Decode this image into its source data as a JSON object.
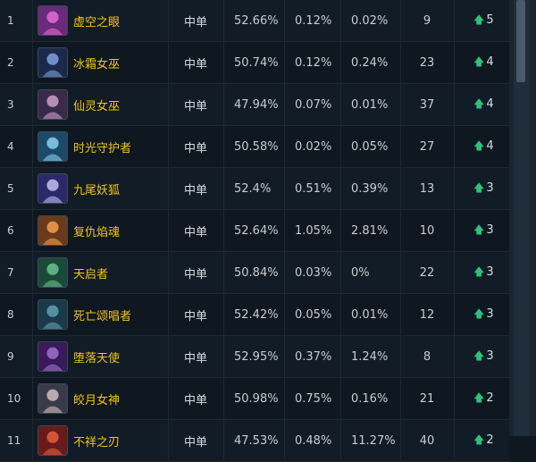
{
  "colors": {
    "name": "#f0c419",
    "trend_up": "#2ec27e"
  },
  "rows": [
    {
      "rank": "1",
      "icon": "champion-portrait-icon",
      "name": "虚空之眼",
      "pos": "中单",
      "win": "52.66%",
      "pick": "0.12%",
      "ban": "0.02%",
      "tier": "9",
      "trend": "5"
    },
    {
      "rank": "2",
      "icon": "champion-portrait-icon",
      "name": "冰霜女巫",
      "pos": "中单",
      "win": "50.74%",
      "pick": "0.12%",
      "ban": "0.24%",
      "tier": "23",
      "trend": "4"
    },
    {
      "rank": "3",
      "icon": "champion-portrait-icon",
      "name": "仙灵女巫",
      "pos": "中单",
      "win": "47.94%",
      "pick": "0.07%",
      "ban": "0.01%",
      "tier": "37",
      "trend": "4"
    },
    {
      "rank": "4",
      "icon": "champion-portrait-icon",
      "name": "时光守护者",
      "pos": "中单",
      "win": "50.58%",
      "pick": "0.02%",
      "ban": "0.05%",
      "tier": "27",
      "trend": "4"
    },
    {
      "rank": "5",
      "icon": "champion-portrait-icon",
      "name": "九尾妖狐",
      "pos": "中单",
      "win": "52.4%",
      "pick": "0.51%",
      "ban": "0.39%",
      "tier": "13",
      "trend": "3"
    },
    {
      "rank": "6",
      "icon": "champion-portrait-icon",
      "name": "复仇焰魂",
      "pos": "中单",
      "win": "52.64%",
      "pick": "1.05%",
      "ban": "2.81%",
      "tier": "10",
      "trend": "3"
    },
    {
      "rank": "7",
      "icon": "champion-portrait-icon",
      "name": "天启者",
      "pos": "中单",
      "win": "50.84%",
      "pick": "0.03%",
      "ban": "0%",
      "tier": "22",
      "trend": "3"
    },
    {
      "rank": "8",
      "icon": "champion-portrait-icon",
      "name": "死亡颂唱者",
      "pos": "中单",
      "win": "52.42%",
      "pick": "0.05%",
      "ban": "0.01%",
      "tier": "12",
      "trend": "3"
    },
    {
      "rank": "9",
      "icon": "champion-portrait-icon",
      "name": "堕落天使",
      "pos": "中单",
      "win": "52.95%",
      "pick": "0.37%",
      "ban": "1.24%",
      "tier": "8",
      "trend": "3"
    },
    {
      "rank": "10",
      "icon": "champion-portrait-icon",
      "name": "皎月女神",
      "pos": "中单",
      "win": "50.98%",
      "pick": "0.75%",
      "ban": "0.16%",
      "tier": "21",
      "trend": "2"
    },
    {
      "rank": "11",
      "icon": "champion-portrait-icon",
      "name": "不祥之刃",
      "pos": "中单",
      "win": "47.53%",
      "pick": "0.48%",
      "ban": "11.27%",
      "tier": "40",
      "trend": "2"
    }
  ]
}
